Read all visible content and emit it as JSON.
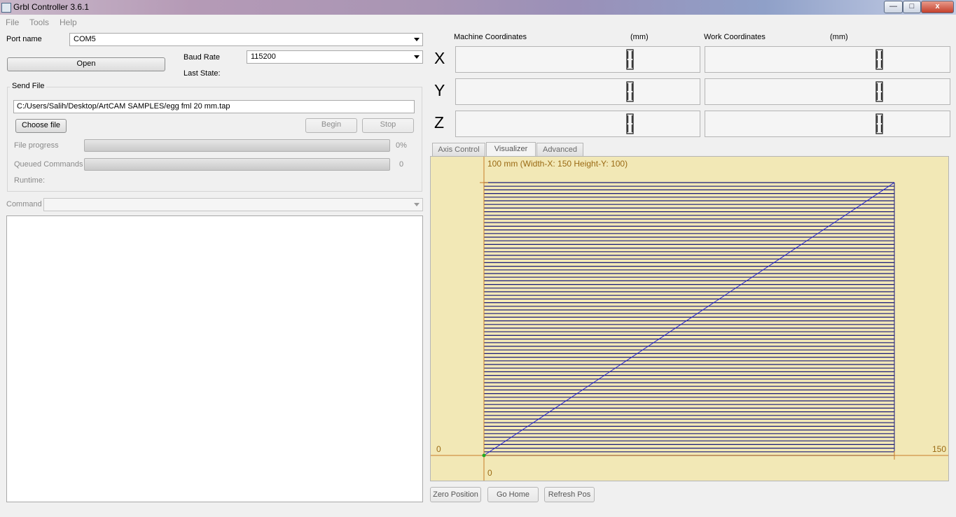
{
  "window": {
    "title": "Grbl Controller 3.6.1",
    "minimize_label": "—",
    "maximize_label": "□",
    "close_label": "x"
  },
  "menu": [
    "File",
    "Tools",
    "Help"
  ],
  "connection": {
    "port_label": "Port name",
    "port_value": "COM5",
    "open_label": "Open",
    "baud_label": "Baud Rate",
    "baud_value": "115200",
    "last_state_label": "Last State:",
    "last_state_value": ""
  },
  "send_file": {
    "group_label": "Send File",
    "file_path": "C:/Users/Salih/Desktop/ArtCAM SAMPLES/egg fml 20 mm.tap",
    "choose_label": "Choose file",
    "begin_label": "Begin",
    "stop_label": "Stop",
    "file_progress_label": "File progress",
    "file_progress_value": "0%",
    "file_progress": 0,
    "queued_label": "Queued Commands",
    "queued_value": "0",
    "queued_progress": 0,
    "runtime_label": "Runtime:"
  },
  "command": {
    "label": "Command",
    "value": ""
  },
  "coordinates": {
    "machine_label": "Machine Coordinates",
    "work_label": "Work Coordinates",
    "unit_label": "(mm)",
    "axes": [
      "X",
      "Y",
      "Z"
    ]
  },
  "tabs": [
    "Axis Control",
    "Visualizer",
    "Advanced"
  ],
  "active_tab": "Visualizer",
  "visualizer": {
    "header": "100 mm  (Width-X: 150  Height-Y: 100)",
    "x_min_label": "0",
    "x_max_label": "150",
    "y_min_label": "0",
    "width_x": 150,
    "height_y": 100,
    "raster_lines": 75,
    "colors": {
      "background": "#f2e8b6",
      "toolpath": "#1a1a7a",
      "diagonal": "#2020d0",
      "axes": "#c87d28",
      "label": "#9a6a14",
      "origin": "#22aa22"
    }
  },
  "bottom_buttons": [
    "Zero Position",
    "Go Home",
    "Refresh Pos"
  ]
}
